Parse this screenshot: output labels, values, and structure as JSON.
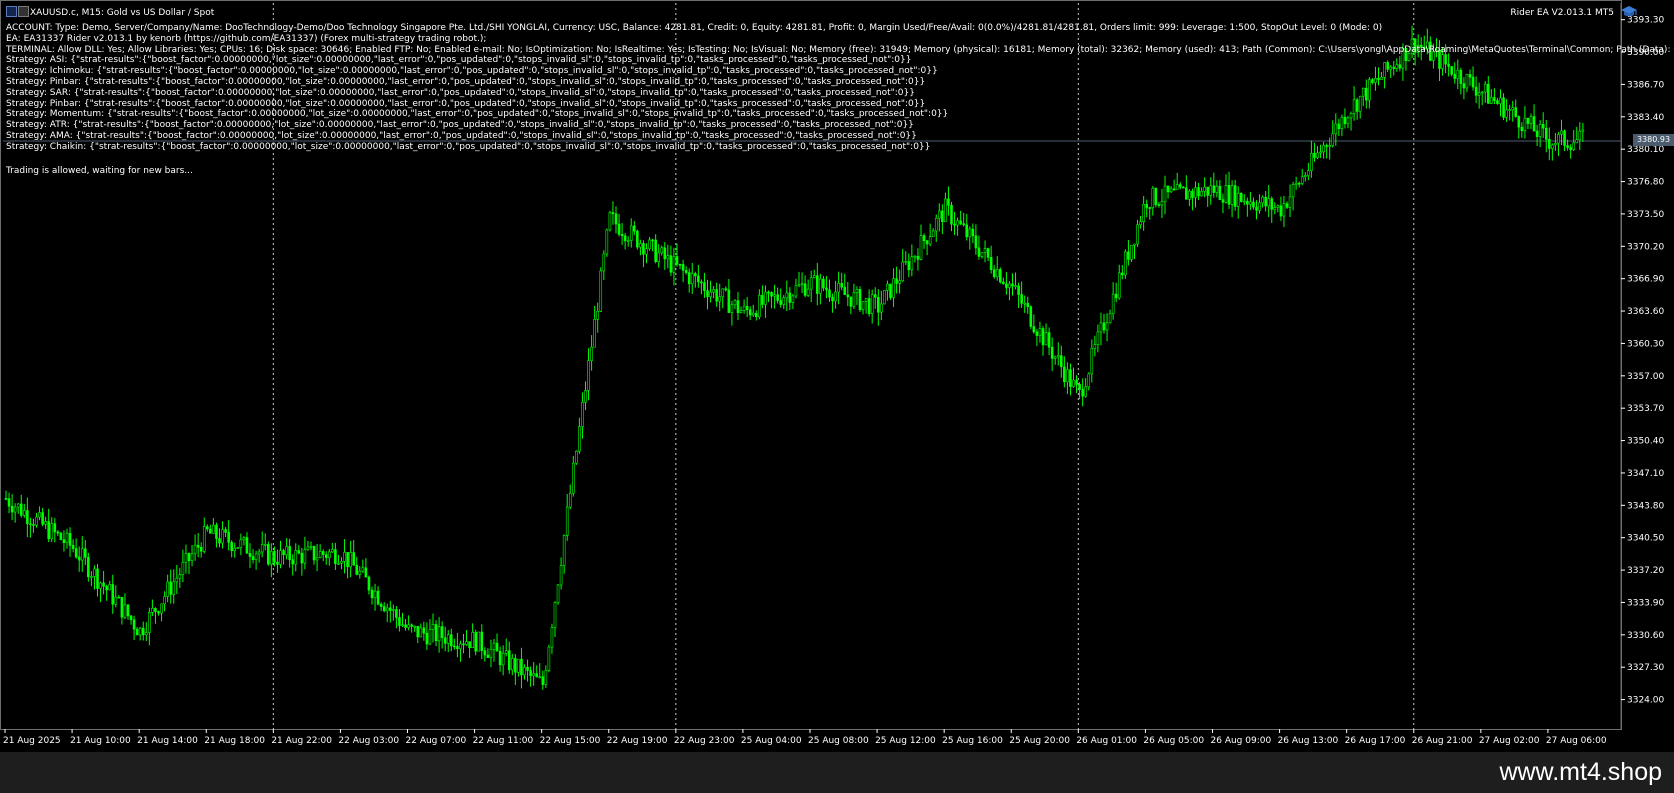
{
  "header": {
    "symbol_line": "XAUUSD.c, M15:  Gold vs US Dollar / Spot",
    "ea_name": "Rider EA V2.013.1 MT5"
  },
  "overlay": {
    "lines": [
      "ACCOUNT: Type: Demo, Server/Company/Name: DooTechnology-Demo/Doo Technology Singapore Pte. Ltd./SHI YONGLAI, Currency: USC, Balance: 4281.81, Credit: 0, Equity: 4281.81, Profit: 0, Margin Used/Free/Avail: 0(0.0%)/4281.81/4281.81, Orders limit: 999: Leverage: 1:500, StopOut Level: 0 (Mode: 0)",
      "EA: EA31337 Rider v2.013.1 by kenorb (https://github.com/EA31337) (Forex multi-strategy trading robot.);",
      "TERMINAL: Allow DLL: Yes; Allow Libraries: Yes; CPUs: 16; Disk space: 30646; Enabled FTP: No; Enabled e-mail: No; IsOptimization: No; IsRealtime: Yes; IsTesting: No; IsVisual: No; Memory (free): 31949; Memory (physical): 16181; Memory (total): 32362; Memory (used): 413; Path (Common): C:\\Users\\yongl\\AppData\\Roaming\\MetaQuotes\\Terminal\\Common; Path (Data): C:\\Users",
      "Strategy: ASI: {\"strat-results\":{\"boost_factor\":0.00000000,\"lot_size\":0.00000000,\"last_error\":0,\"pos_updated\":0,\"stops_invalid_sl\":0,\"stops_invalid_tp\":0,\"tasks_processed\":0,\"tasks_processed_not\":0}}",
      "Strategy: Ichimoku: {\"strat-results\":{\"boost_factor\":0.00000000,\"lot_size\":0.00000000,\"last_error\":0,\"pos_updated\":0,\"stops_invalid_sl\":0,\"stops_invalid_tp\":0,\"tasks_processed\":0,\"tasks_processed_not\":0}}",
      "Strategy: Pinbar: {\"strat-results\":{\"boost_factor\":0.00000000,\"lot_size\":0.00000000,\"last_error\":0,\"pos_updated\":0,\"stops_invalid_sl\":0,\"stops_invalid_tp\":0,\"tasks_processed\":0,\"tasks_processed_not\":0}}",
      "Strategy: SAR: {\"strat-results\":{\"boost_factor\":0.00000000,\"lot_size\":0.00000000,\"last_error\":0,\"pos_updated\":0,\"stops_invalid_sl\":0,\"stops_invalid_tp\":0,\"tasks_processed\":0,\"tasks_processed_not\":0}}",
      "Strategy: Pinbar: {\"strat-results\":{\"boost_factor\":0.00000000,\"lot_size\":0.00000000,\"last_error\":0,\"pos_updated\":0,\"stops_invalid_sl\":0,\"stops_invalid_tp\":0,\"tasks_processed\":0,\"tasks_processed_not\":0}}",
      "Strategy: Momentum: {\"strat-results\":{\"boost_factor\":0.00000000,\"lot_size\":0.00000000,\"last_error\":0,\"pos_updated\":0,\"stops_invalid_sl\":0,\"stops_invalid_tp\":0,\"tasks_processed\":0,\"tasks_processed_not\":0}}",
      "Strategy: ATR: {\"strat-results\":{\"boost_factor\":0.00000000,\"lot_size\":0.00000000,\"last_error\":0,\"pos_updated\":0,\"stops_invalid_sl\":0,\"stops_invalid_tp\":0,\"tasks_processed\":0,\"tasks_processed_not\":0}}",
      "Strategy: AMA: {\"strat-results\":{\"boost_factor\":0.00000000,\"lot_size\":0.00000000,\"last_error\":0,\"pos_updated\":0,\"stops_invalid_sl\":0,\"stops_invalid_tp\":0,\"tasks_processed\":0,\"tasks_processed_not\":0}}",
      "Strategy: Chaikin: {\"strat-results\":{\"boost_factor\":0.00000000,\"lot_size\":0.00000000,\"last_error\":0,\"pos_updated\":0,\"stops_invalid_sl\":0,\"stops_invalid_tp\":0,\"tasks_processed\":0,\"tasks_processed_not\":0}}"
    ],
    "status": "Trading is allowed, waiting for new bars..."
  },
  "watermark": "www.mt4.shop",
  "colors": {
    "background": "#000000",
    "candle": "#00ff00",
    "grid_separator": "#ffffff",
    "price_line": "#4b5c6e",
    "axis_text": "#ffffff",
    "footer": "#1e1e1e"
  },
  "chart_data": {
    "type": "candlestick",
    "symbol": "XAUUSD.c",
    "timeframe": "M15",
    "ylim": [
      3321.0,
      3395.0
    ],
    "y_ticks": [
      "3393.30",
      "3390.00",
      "3386.70",
      "3383.40",
      "3380.10",
      "3376.80",
      "3373.50",
      "3370.20",
      "3366.90",
      "3363.60",
      "3360.30",
      "3357.00",
      "3353.70",
      "3350.40",
      "3347.10",
      "3343.80",
      "3340.50",
      "3337.20",
      "3333.90",
      "3330.60",
      "3327.30",
      "3324.00"
    ],
    "x_ticks": [
      "21 Aug 2025",
      "21 Aug 10:00",
      "21 Aug 14:00",
      "21 Aug 18:00",
      "21 Aug 22:00",
      "22 Aug 03:00",
      "22 Aug 07:00",
      "22 Aug 11:00",
      "22 Aug 15:00",
      "22 Aug 19:00",
      "22 Aug 23:00",
      "25 Aug 04:00",
      "25 Aug 08:00",
      "25 Aug 12:00",
      "25 Aug 16:00",
      "25 Aug 20:00",
      "26 Aug 01:00",
      "26 Aug 05:00",
      "26 Aug 09:00",
      "26 Aug 13:00",
      "26 Aug 17:00",
      "26 Aug 21:00",
      "27 Aug 02:00",
      "27 Aug 06:00"
    ],
    "day_separators": [
      "21 Aug 22:00",
      "22 Aug 23:00",
      "26 Aug 01:00",
      "26 Aug 21:00"
    ],
    "last_price": "3380.93",
    "close_path": [
      [
        "21 Aug 2025",
        3344.5
      ],
      [
        "21 Aug 10:00",
        3339.5
      ],
      [
        "21 Aug 14:00",
        3331.0
      ],
      [
        "21 Aug 18:00",
        3341.0
      ],
      [
        "21 Aug 22:00",
        3338.5
      ],
      [
        "22 Aug 03:00",
        3339.0
      ],
      [
        "22 Aug 07:00",
        3331.0
      ],
      [
        "22 Aug 11:00",
        3330.0
      ],
      [
        "22 Aug 15:00",
        3325.5
      ],
      [
        "22 Aug 19:00",
        3373.0
      ],
      [
        "22 Aug 23:00",
        3368.0
      ],
      [
        "25 Aug 04:00",
        3363.5
      ],
      [
        "25 Aug 08:00",
        3366.5
      ],
      [
        "25 Aug 12:00",
        3364.0
      ],
      [
        "25 Aug 16:00",
        3374.0
      ],
      [
        "25 Aug 20:00",
        3366.0
      ],
      [
        "26 Aug 01:00",
        3355.0
      ],
      [
        "26 Aug 05:00",
        3375.0
      ],
      [
        "26 Aug 09:00",
        3376.0
      ],
      [
        "26 Aug 13:00",
        3374.0
      ],
      [
        "26 Aug 17:00",
        3384.0
      ],
      [
        "26 Aug 21:00",
        3391.0
      ],
      [
        "27 Aug 02:00",
        3386.0
      ],
      [
        "27 Aug 06:00",
        3381.0
      ]
    ]
  }
}
